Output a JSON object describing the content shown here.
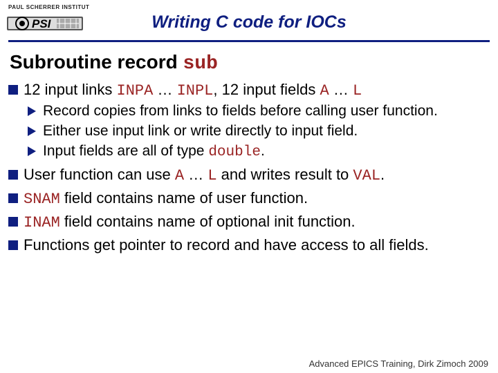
{
  "header": {
    "institute": "PAUL SCHERRER INSTITUT",
    "title": "Writing C code for IOCs"
  },
  "subtitle": {
    "prefix": "Subroutine record ",
    "code": "sub"
  },
  "b1": {
    "a": "12 input links ",
    "b": "INPA",
    "c": " … ",
    "d": "INPL",
    "e": ", 12 input fields ",
    "f": "A",
    "g": " … ",
    "h": "L"
  },
  "s1": "Record copies from links to fields before calling user function.",
  "s2": "Either use input link or write directly to input field.",
  "s3a": "Input fields are all of type ",
  "s3b": "double",
  "s3c": ".",
  "b2": {
    "a": "User function can use ",
    "b": "A",
    "c": " … ",
    "d": "L",
    "e": " and writes result to ",
    "f": "VAL",
    "g": "."
  },
  "b3": {
    "a": "SNAM",
    "b": " field contains name of user function."
  },
  "b4": {
    "a": "INAM",
    "b": " field contains name of optional init function."
  },
  "b5": "Functions get pointer to record and have access to all fields.",
  "footer": "Advanced EPICS Training, Dirk Zimoch 2009"
}
